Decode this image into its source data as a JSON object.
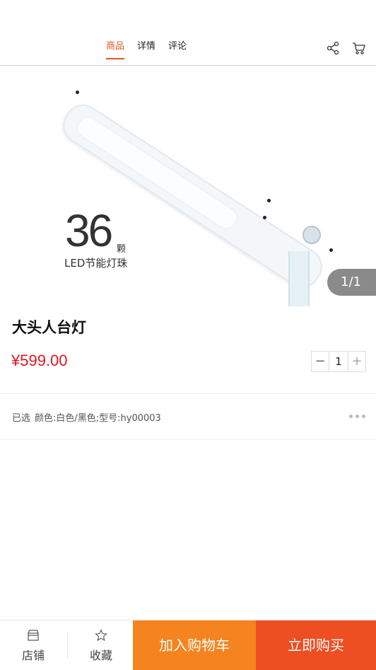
{
  "header": {
    "tabs": [
      {
        "label": "商品"
      },
      {
        "label": "详情"
      },
      {
        "label": "评论"
      }
    ]
  },
  "gallery": {
    "image_text_number": "36",
    "image_text_unit": "颗",
    "image_text_sub": "LED节能灯珠",
    "pager": "1/1"
  },
  "product": {
    "title": "大头人台灯",
    "price": "¥599.00",
    "quantity": "1"
  },
  "spec": {
    "label": "已选",
    "value": "颜色:白色/黑色;型号:hy00003"
  },
  "bottom_bar": {
    "store_label": "店铺",
    "favorite_label": "收藏",
    "add_to_cart_label": "加入购物车",
    "buy_now_label": "立即购买"
  },
  "colors": {
    "accent": "#e8541e",
    "price": "#e4141c",
    "add_to_cart": "#f5831f",
    "buy_now": "#ed4e22"
  },
  "icons": [
    "share-icon",
    "cart-icon",
    "store-icon",
    "star-icon",
    "more-icon"
  ]
}
